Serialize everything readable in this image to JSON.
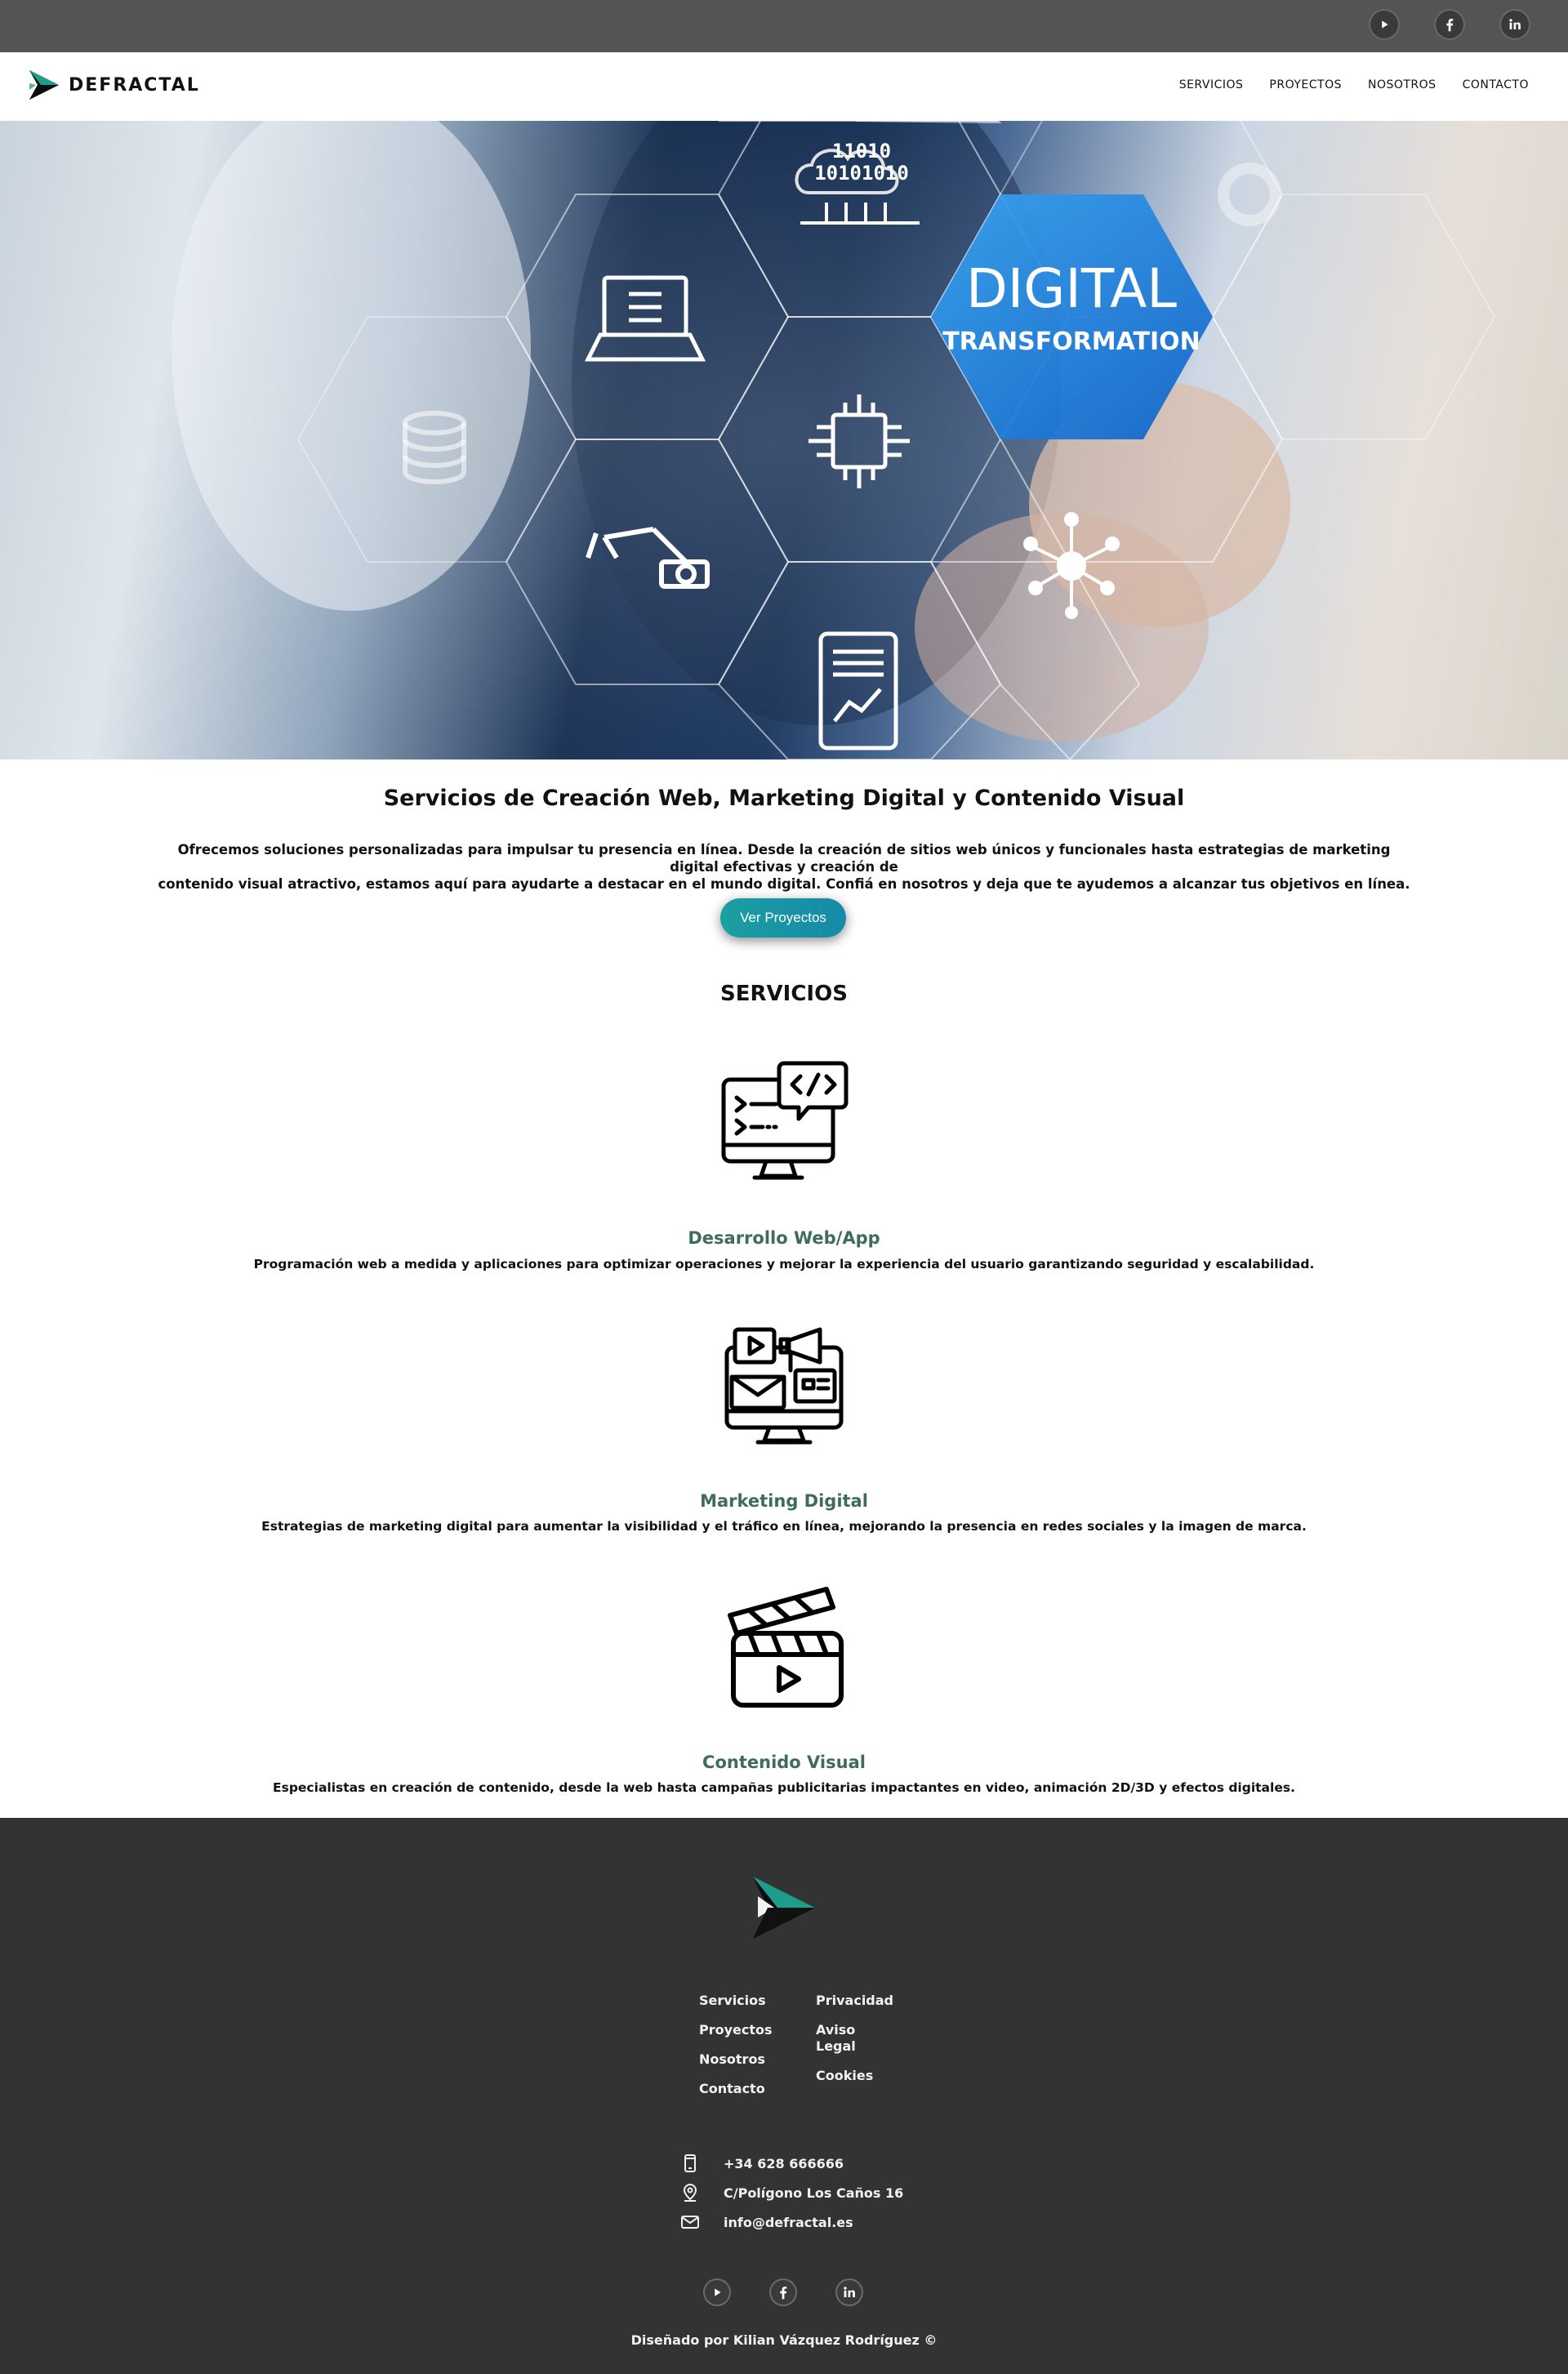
{
  "top_bar": {
    "social": [
      {
        "icon": "youtube-icon"
      },
      {
        "icon": "facebook-icon"
      },
      {
        "icon": "linkedin-icon"
      }
    ]
  },
  "nav": {
    "brand": "DEFRACTAL",
    "links": [
      "SERVICIOS",
      "PROYECTOS",
      "NOSOTROS",
      "CONTACTO"
    ]
  },
  "hero": {
    "headline_line1": "DIGITAL",
    "headline_line2": "TRANSFORMATION",
    "binary_line1": "11010",
    "binary_line2": "10101010"
  },
  "intro": {
    "title": "Servicios de Creación Web, Marketing Digital y Contenido Visual",
    "text_line1": "Ofrecemos soluciones personalizadas para impulsar tu presencia en línea. Desde la creación de sitios web únicos y funcionales hasta estrategias de marketing digital efectivas y creación de",
    "text_line2": "contenido visual atractivo, estamos aquí para ayudarte a destacar en el mundo digital. Confiá en nosotros y deja que te ayudemos a alcanzar tus objetivos en línea.",
    "cta_label": "Ver Proyectos"
  },
  "services": {
    "heading": "SERVICIOS",
    "items": [
      {
        "icon": "web-development-icon",
        "title": "Desarrollo Web/App",
        "description": "Programación web a medida y aplicaciones para optimizar operaciones y mejorar la experiencia del usuario garantizando seguridad y escalabilidad."
      },
      {
        "icon": "digital-marketing-icon",
        "title": "Marketing Digital",
        "description": "Estrategias de marketing digital para aumentar la visibilidad y el tráfico en línea, mejorando la presencia en redes sociales y la imagen de marca."
      },
      {
        "icon": "clapperboard-icon",
        "title": "Contenido Visual",
        "description": "Especialistas en creación de contenido, desde la web hasta campañas publicitarias impactantes en video, animación 2D/3D y efectos digitales."
      }
    ]
  },
  "footer": {
    "links_col1": [
      "Servicios",
      "Proyectos",
      "Nosotros",
      "Contacto"
    ],
    "links_col2": [
      "Privacidad",
      "Aviso",
      "Legal",
      "Cookies"
    ],
    "contact": {
      "phone": "+34 628 666666",
      "address": "C/Polígono Los Caños 16",
      "email": "info@defractal.es"
    },
    "credit": "Diseñado por Kilian Vázquez Rodríguez ©"
  },
  "colors": {
    "top_bar": "#545454",
    "footer": "#333333",
    "accent_teal": "#1aa0a2",
    "service_title": "#3e6b5c"
  }
}
